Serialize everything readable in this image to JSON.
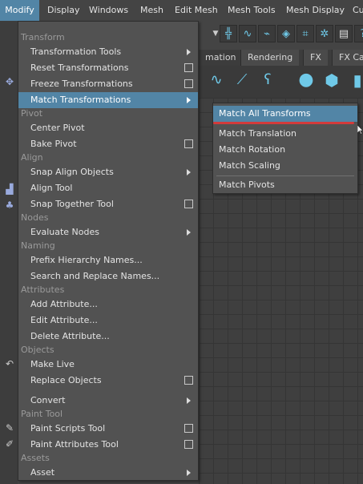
{
  "menubar": {
    "items": [
      {
        "label": "Modify"
      },
      {
        "label": "Display"
      },
      {
        "label": "Windows"
      },
      {
        "label": "Mesh"
      },
      {
        "label": "Edit Mesh"
      },
      {
        "label": "Mesh Tools"
      },
      {
        "label": "Mesh Display"
      },
      {
        "label": "Cu"
      }
    ]
  },
  "background": {
    "shelf_tabs": [
      {
        "label": "mation"
      },
      {
        "label": "Rendering"
      },
      {
        "label": "FX"
      },
      {
        "label": "FX Ca"
      }
    ]
  },
  "main_menu": {
    "sections": {
      "transform": "Transform",
      "pivot": "Pivot",
      "align": "Align",
      "nodes": "Nodes",
      "naming": "Naming",
      "attributes": "Attributes",
      "objects": "Objects",
      "paint_tool": "Paint Tool",
      "assets": "Assets"
    },
    "items": {
      "transformation_tools": "Transformation Tools",
      "reset_transformations": "Reset Transformations",
      "freeze_transformations": "Freeze Transformations",
      "match_transformations": "Match Transformations",
      "center_pivot": "Center Pivot",
      "bake_pivot": "Bake Pivot",
      "snap_align_objects": "Snap Align Objects",
      "align_tool": "Align Tool",
      "snap_together_tool": "Snap Together Tool",
      "evaluate_nodes": "Evaluate Nodes",
      "prefix_hierarchy_names": "Prefix Hierarchy Names...",
      "search_and_replace_names": "Search and Replace Names...",
      "add_attribute": "Add Attribute...",
      "edit_attribute": "Edit Attribute...",
      "delete_attribute": "Delete Attribute...",
      "make_live": "Make Live",
      "replace_objects": "Replace Objects",
      "convert": "Convert",
      "paint_scripts_tool": "Paint Scripts Tool",
      "paint_attributes_tool": "Paint Attributes Tool",
      "asset": "Asset"
    }
  },
  "sub_menu": {
    "items": {
      "match_all_transforms": "Match All Transforms",
      "match_translation": "Match Translation",
      "match_rotation": "Match Rotation",
      "match_scaling": "Match Scaling",
      "match_pivots": "Match Pivots"
    }
  },
  "colors": {
    "highlight": "#5285a6",
    "menu_bg": "#525252",
    "underline": "#d23b3b"
  }
}
